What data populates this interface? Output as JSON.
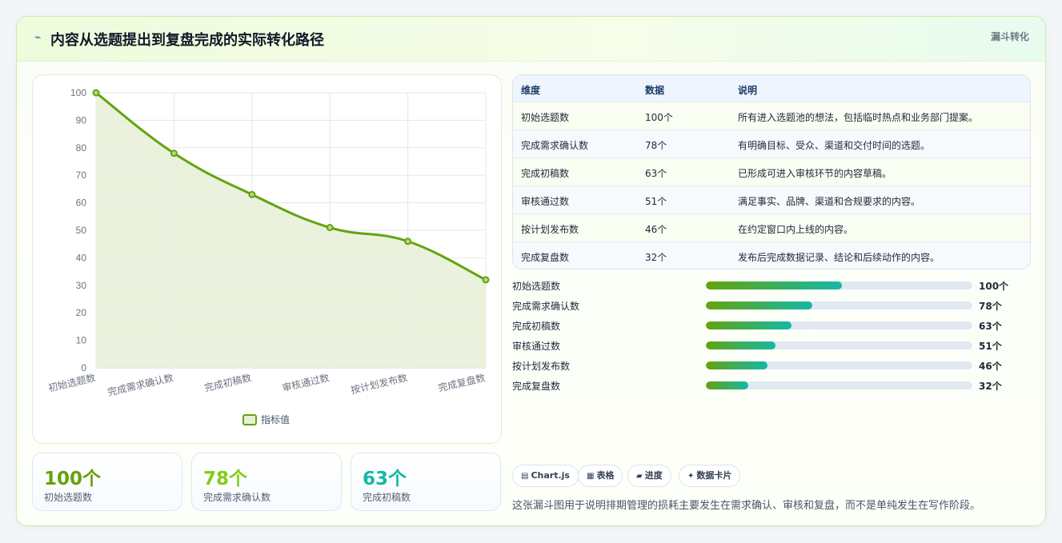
{
  "header": {
    "icon": "trend-icon",
    "title": "内容从选题提出到复盘完成的实际转化路径",
    "badge": "漏斗转化"
  },
  "chart_data": {
    "type": "line",
    "categories": [
      "初始选题数",
      "完成需求确认数",
      "完成初稿数",
      "审核通过数",
      "按计划发布数",
      "完成复盘数"
    ],
    "series": [
      {
        "name": "指标值",
        "values": [
          100,
          78,
          63,
          51,
          46,
          32
        ]
      }
    ],
    "ylim": [
      0,
      100
    ],
    "yticks": [
      "0",
      "10",
      "20",
      "30",
      "40",
      "50",
      "60",
      "70",
      "80",
      "90",
      "100"
    ],
    "legend_position": "bottom",
    "grid": true,
    "area_fill": true,
    "colors": {
      "line": "#65a30d",
      "fill": "#e6f0d8"
    }
  },
  "kpis": [
    {
      "value": "100个",
      "label": "初始选题数",
      "color": "#65a30d"
    },
    {
      "value": "78个",
      "label": "完成需求确认数",
      "color": "#84cc16"
    },
    {
      "value": "63个",
      "label": "完成初稿数",
      "color": "#14b8a6"
    }
  ],
  "table": {
    "headers": [
      "维度",
      "数据",
      "说明"
    ],
    "rows": [
      [
        "初始选题数",
        "100个",
        "所有进入选题池的想法，包括临时热点和业务部门提案。"
      ],
      [
        "完成需求确认数",
        "78个",
        "有明确目标、受众、渠道和交付时间的选题。"
      ],
      [
        "完成初稿数",
        "63个",
        "已形成可进入审核环节的内容草稿。"
      ],
      [
        "审核通过数",
        "51个",
        "满足事实、品牌、渠道和合规要求的内容。"
      ],
      [
        "按计划发布数",
        "46个",
        "在约定窗口内上线的内容。"
      ],
      [
        "完成复盘数",
        "32个",
        "发布后完成数据记录、结论和后续动作的内容。"
      ]
    ]
  },
  "progress": [
    {
      "label": "初始选题数",
      "value": "100个",
      "fraction": 0.51
    },
    {
      "label": "完成需求确认数",
      "value": "78个",
      "fraction": 0.4
    },
    {
      "label": "完成初稿数",
      "value": "63个",
      "fraction": 0.32
    },
    {
      "label": "审核通过数",
      "value": "51个",
      "fraction": 0.26
    },
    {
      "label": "按计划发布数",
      "value": "46个",
      "fraction": 0.23
    },
    {
      "label": "完成复盘数",
      "value": "32个",
      "fraction": 0.16
    }
  ],
  "chips": [
    {
      "icon": "chart-icon",
      "glyph": "▤",
      "label": "Chart.js"
    },
    {
      "icon": "table-icon",
      "glyph": "▦",
      "label": "表格"
    },
    {
      "icon": "progress-icon",
      "glyph": "▰",
      "label": "进度"
    },
    {
      "icon": "card-icon",
      "glyph": "✦",
      "label": "数据卡片"
    }
  ],
  "footer_note": "这张漏斗图用于说明排期管理的损耗主要发生在需求确认、审核和复盘，而不是单纯发生在写作阶段。"
}
